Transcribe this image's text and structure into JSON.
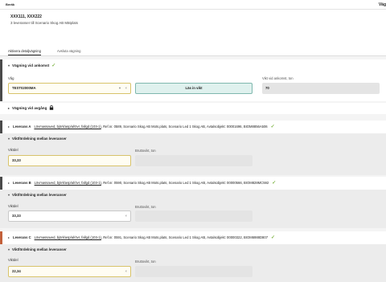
{
  "topbar": {
    "left": "Beräk",
    "right": "Väg"
  },
  "header": {
    "title": "XXX111, XXX222",
    "subtitle": "3 leveranser till Scenario Skog AB Mätplats"
  },
  "tabs": [
    {
      "label": "Aktivera detaljvägning"
    },
    {
      "label": "Avsluta vägning"
    }
  ],
  "ankomst": {
    "title": "Vägning vid ankomst",
    "vag_label": "Våg",
    "vag_value": "TEST02000MA",
    "las_button": "Läs in vikt",
    "vikt_label": "Vikt vid ankomst, ton",
    "vikt_value": "70"
  },
  "avgang": {
    "title": "Vägning vid avgång"
  },
  "leveranser": [
    {
      "name": "Leverans A",
      "link": "Lövmassaved, björk/asp/al/övr, fallgd (103-1)",
      "info": ", Ref.nr. 0589, Scenario Skog AB Mots.plats, Scenario Led 1 Skog AB, Avtalsobjekt: 00001696, BIOM8856A506",
      "sub_title": "Viktfördelning mellan leveranser",
      "field_label": "Viktdel",
      "field_value": "33,33",
      "brutto_label": "Bruttovikt, ton"
    },
    {
      "name": "Leverans B",
      "link": "Lövmassaved, björk/asp/al/övr, fallgd (103-1)",
      "info": ", Ref.nr. 0590, Scenario Skog AB Mots.plats, Scenario Led 1 Skog AB, Avtalsobjekt: 00000566, BIOM828MC592",
      "sub_title": "Viktfördelning mellan leveranser",
      "field_label": "Viktdel",
      "field_value": "33,33",
      "brutto_label": "Bruttovikt, ton"
    },
    {
      "name": "Leverans C",
      "link": "Lövmassaved, björk/asp/al/övr, fallgd (103-1)",
      "info": ", Ref.nr. 0591, Scenario Skog AB Mots.plats, Scenario Led 1 Skog AB, Avtalsobjekt: 00000322, BIOM6988D807",
      "sub_title": "Viktfördelning mellan leveranser",
      "field_label": "Viktdel",
      "field_value": "22,34",
      "brutto_label": "Bruttovikt, ton"
    }
  ],
  "colors": {
    "stripe": "#4a4a4a",
    "stripe_c": "#c2603a",
    "check": "#7cb342",
    "button_bg": "#dff1ee"
  },
  "icons": {
    "check": "check-icon",
    "lock": "lock-icon",
    "chevron": "chevron-icon",
    "clear": "clear-icon"
  }
}
